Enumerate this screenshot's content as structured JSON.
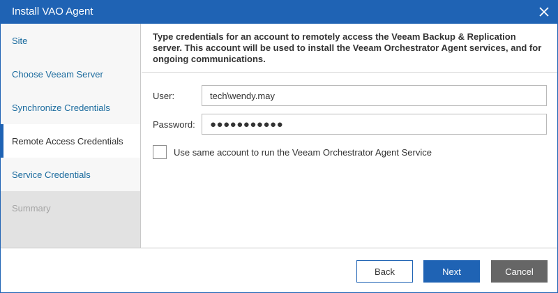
{
  "window": {
    "title": "Install VAO Agent",
    "close_icon": "close-icon",
    "accent_color": "#1f63b4"
  },
  "steps": [
    {
      "label": "Site",
      "state": "done"
    },
    {
      "label": "Choose Veeam Server",
      "state": "done"
    },
    {
      "label": "Synchronize Credentials",
      "state": "done"
    },
    {
      "label": "Remote Access Credentials",
      "state": "active"
    },
    {
      "label": "Service Credentials",
      "state": "pending"
    },
    {
      "label": "Summary",
      "state": "disabled"
    }
  ],
  "content": {
    "intro": "Type credentials for an account to remotely access the Veeam Backup & Replication server. This account will be used to install the Veeam Orchestrator Agent services, and for ongoing communications.",
    "user_label": "User:",
    "user_value": "tech\\wendy.may",
    "password_label": "Password:",
    "password_value": "●●●●●●●●●●●",
    "same_account_label": "Use same account to run the Veeam Orchestrator Agent Service",
    "same_account_checked": false
  },
  "footer": {
    "back_label": "Back",
    "next_label": "Next",
    "cancel_label": "Cancel"
  }
}
